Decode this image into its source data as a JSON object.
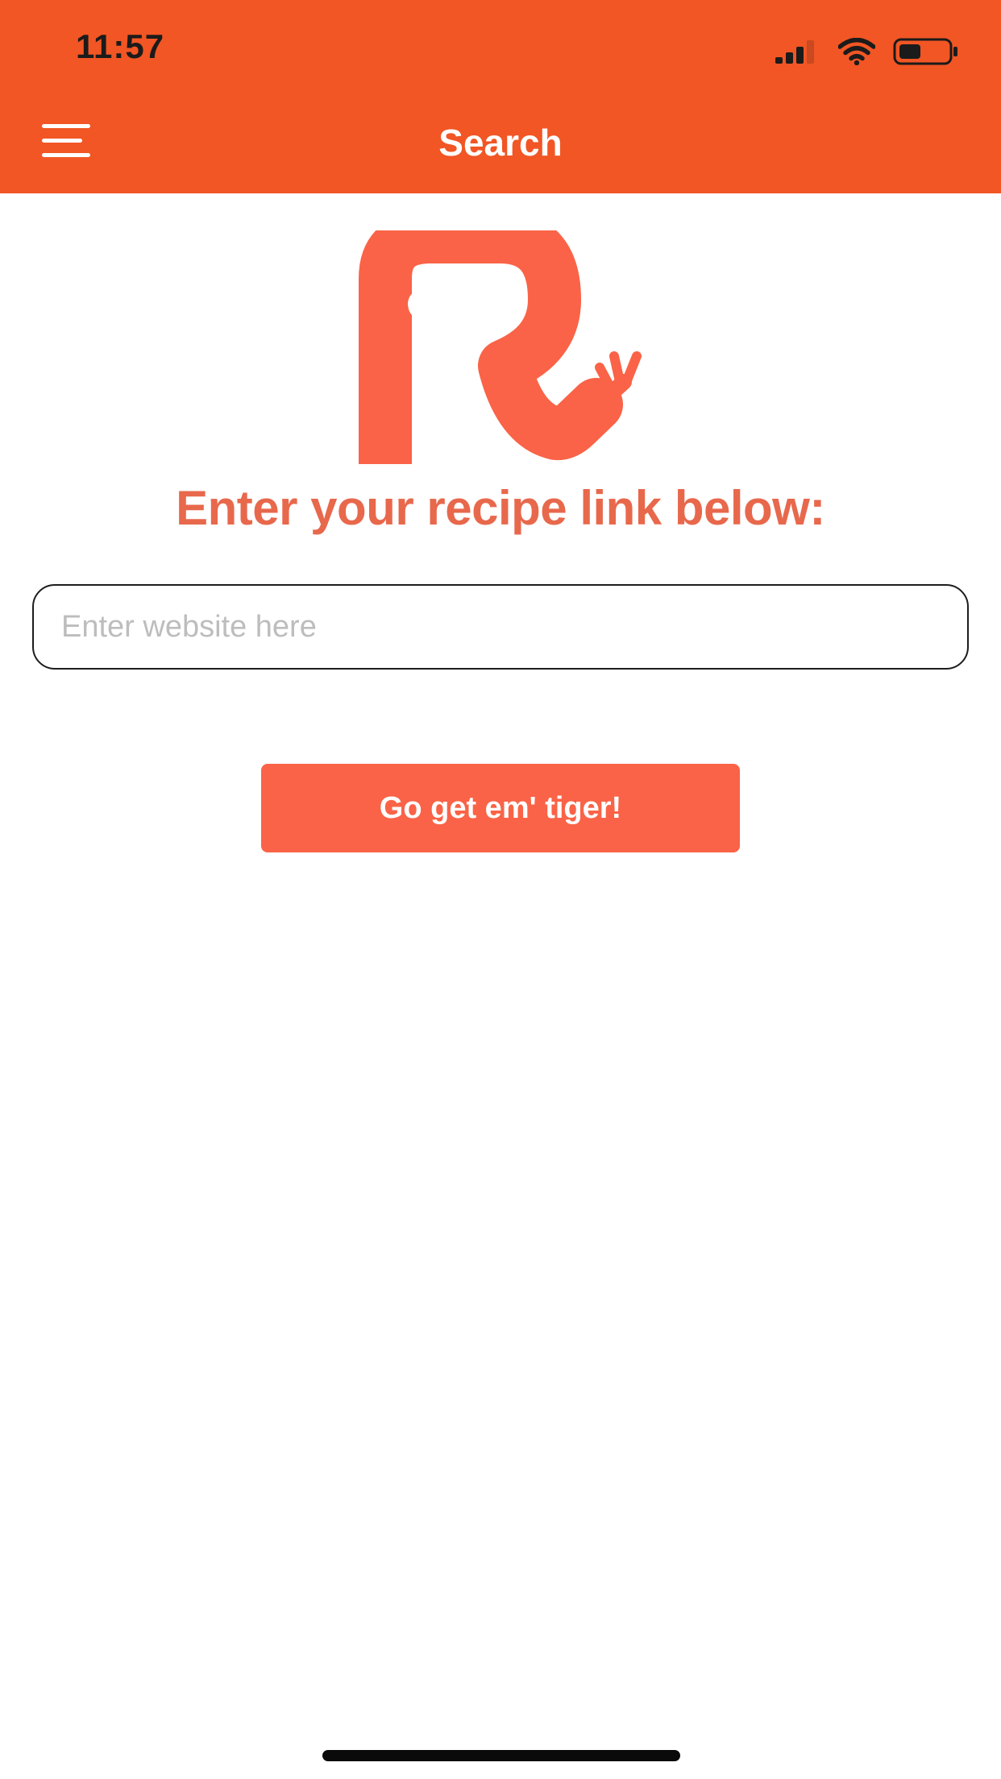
{
  "status_bar": {
    "time": "11:57",
    "icons": [
      "cellular-signal-icon",
      "wifi-icon",
      "battery-icon"
    ]
  },
  "nav": {
    "title": "Search",
    "menu_icon": "hamburger-menu-icon"
  },
  "logo": {
    "icon": "recipe-r-fork-logo"
  },
  "main": {
    "headline": "Enter your recipe link below:",
    "url_input": {
      "value": "",
      "placeholder": "Enter website here"
    },
    "submit_label": "Go get em' tiger!"
  },
  "colors": {
    "header": "#f15624",
    "accent": "#fa6347",
    "headline": "#e8684c",
    "placeholder": "#bdbdbd"
  }
}
